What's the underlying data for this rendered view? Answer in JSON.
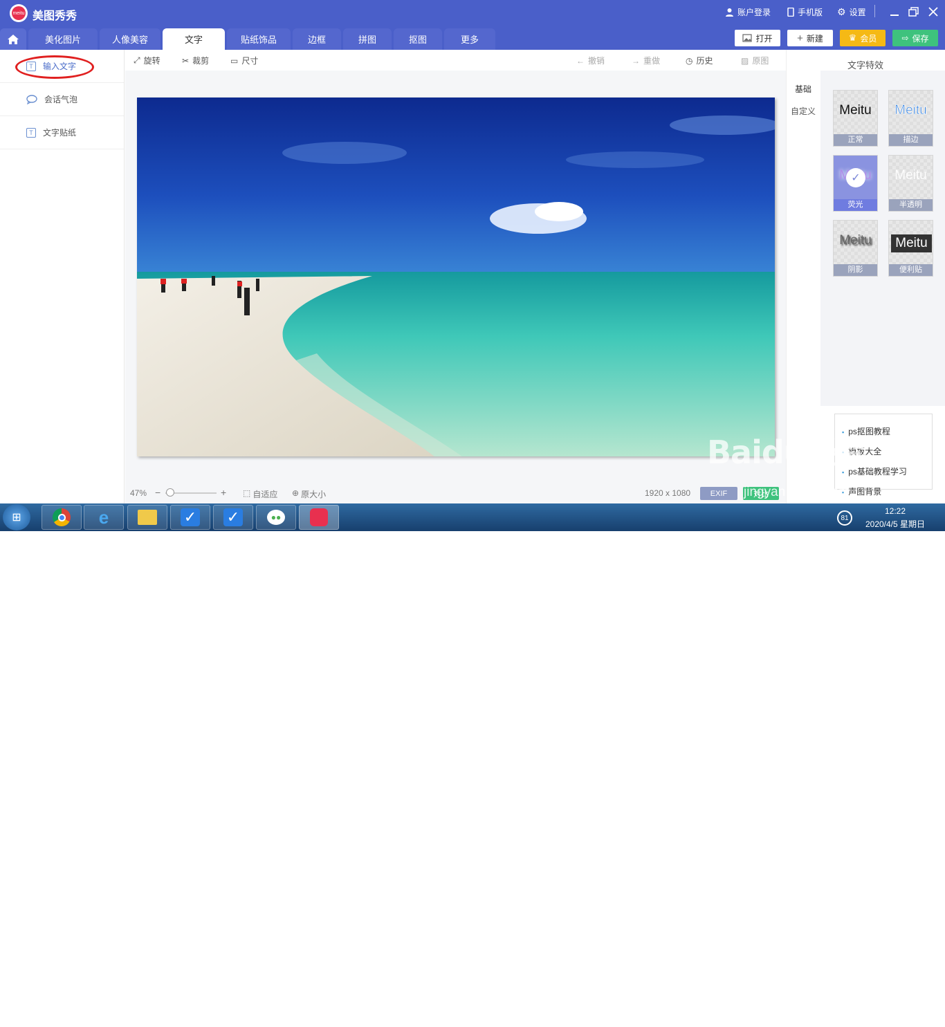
{
  "app": {
    "title": "美图秀秀",
    "logo_text": "meitu"
  },
  "top_right": {
    "account": "账户登录",
    "mobile": "手机版",
    "settings": "设置"
  },
  "tabs": [
    {
      "label": "美化图片"
    },
    {
      "label": "人像美容"
    },
    {
      "label": "文字",
      "active": true
    },
    {
      "label": "贴纸饰品"
    },
    {
      "label": "边框"
    },
    {
      "label": "拼图"
    },
    {
      "label": "抠图"
    },
    {
      "label": "更多"
    }
  ],
  "actions": {
    "open": "打开",
    "new": "新建",
    "vip": "会员",
    "save": "保存"
  },
  "sidebar": {
    "items": [
      {
        "label": "输入文字",
        "icon": "text-icon"
      },
      {
        "label": "会话气泡",
        "icon": "bubble-icon"
      },
      {
        "label": "文字贴纸",
        "icon": "text-sticker-icon"
      }
    ]
  },
  "toolbar": {
    "rotate": "旋转",
    "crop": "裁剪",
    "size": "尺寸",
    "undo": "撤销",
    "redo": "重做",
    "history": "历史",
    "original": "原图"
  },
  "status": {
    "zoom": "47%",
    "zoom_level": 0.1,
    "minus": "−",
    "plus": "+",
    "fit": "自适应",
    "actual": "原大小",
    "dimensions": "1920 x 1080",
    "exif": "EXIF",
    "compare": "对比"
  },
  "right_panel": {
    "title": "文字特效",
    "nav": [
      "基础",
      "自定义"
    ],
    "effects": [
      {
        "sample": "Meitu",
        "label": "正常"
      },
      {
        "sample": "Meitu",
        "label": "描边"
      },
      {
        "sample": "Meitu",
        "label": "荧光",
        "selected": true
      },
      {
        "sample": "Meitu",
        "label": "半透明"
      },
      {
        "sample": "Meitu",
        "label": "阴影"
      },
      {
        "sample": "Meitu",
        "label": "便利贴"
      }
    ],
    "links": [
      "ps抠图教程",
      "模板大全",
      "ps基础教程学习",
      "声图背景"
    ]
  },
  "taskbar": {
    "clock_time": "12:22",
    "clock_date": "2020/4/5 星期日",
    "tray_badge": "81"
  },
  "watermark": "Baidu经验",
  "watermark_url": "jingyan.baidu.com",
  "colors": {
    "brand": "#4a5fc9",
    "vip": "#f5b915",
    "save": "#3ec27d",
    "selected_ring": "#e02020"
  }
}
